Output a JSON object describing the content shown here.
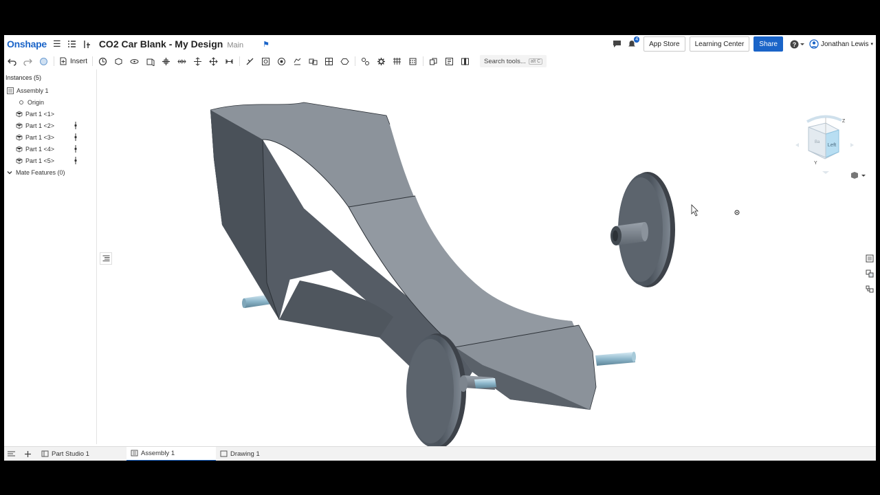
{
  "header": {
    "logo": "Onshape",
    "doc_title": "CO2 Car Blank - My Design",
    "branch": "Main",
    "notifications_count": "4",
    "app_store": "App Store",
    "learning_center": "Learning Center",
    "share": "Share",
    "help": "?",
    "user_name": "Jonathan Lewis"
  },
  "toolbar": {
    "insert_label": "Insert",
    "search_placeholder": "Search tools...",
    "search_shortcut": "alt C"
  },
  "left_panel": {
    "title": "Instances (5)",
    "tree": [
      {
        "label": "Assembly 1",
        "kind": "assembly"
      },
      {
        "label": "Origin",
        "kind": "origin"
      },
      {
        "label": "Part 1 <1>",
        "kind": "part",
        "mated": false
      },
      {
        "label": "Part 1 <2>",
        "kind": "part",
        "mated": true
      },
      {
        "label": "Part 1 <3>",
        "kind": "part",
        "mated": true
      },
      {
        "label": "Part 1 <4>",
        "kind": "part",
        "mated": true
      },
      {
        "label": "Part 1 <5>",
        "kind": "part",
        "mated": true
      }
    ],
    "mate_features": "Mate Features (0)"
  },
  "view_cube": {
    "face": "Left",
    "axis_z": "Z",
    "axis_y": "Y"
  },
  "tabs": [
    {
      "label": "Part Studio 1",
      "active": false
    },
    {
      "label": "Assembly 1",
      "active": true
    },
    {
      "label": "Drawing 1",
      "active": false
    }
  ],
  "colors": {
    "brand": "#1a64c8",
    "part_body": "#6b7480",
    "axle": "#8fb8cc"
  }
}
